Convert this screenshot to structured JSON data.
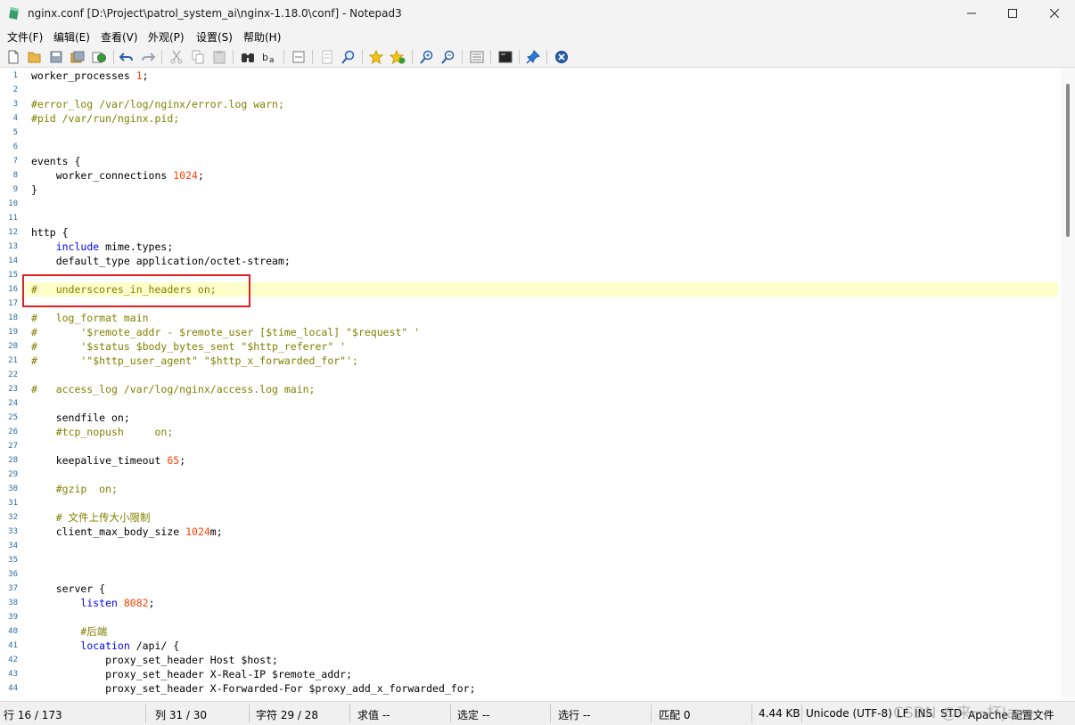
{
  "window": {
    "title": "nginx.conf [D:\\Project\\patrol_system_ai\\nginx-1.18.0\\conf] - Notepad3"
  },
  "menu": [
    "文件(F)",
    "编辑(E)",
    "查看(V)",
    "外观(P)",
    "设置(S)",
    "帮助(H)"
  ],
  "toolbar_icons": [
    "new-file-icon",
    "open-folder-icon",
    "save-icon",
    "save-all-icon",
    "browse-icon",
    "undo-icon",
    "redo-icon",
    "cut-icon",
    "copy-icon",
    "paste-icon",
    "find-icon",
    "replace-icon",
    "word-wrap-icon",
    "line-numbers-icon",
    "zoom-find-icon",
    "favorite-star-icon",
    "add-favorite-icon",
    "zoom-in-icon",
    "zoom-out-icon",
    "settings-list-icon",
    "run-icon",
    "pin-icon",
    "exit-icon"
  ],
  "editor": {
    "current_line": 16,
    "lines": [
      [
        {
          "t": "worker_processes "
        },
        {
          "t": "1",
          "c": "num"
        },
        {
          "t": ";"
        }
      ],
      [],
      [
        {
          "t": "#error_log /var/log/nginx/error.log warn;",
          "c": "cmt"
        }
      ],
      [
        {
          "t": "#pid /var/run/nginx.pid;",
          "c": "cmt"
        }
      ],
      [],
      [],
      [
        {
          "t": "events {"
        }
      ],
      [
        {
          "t": "    worker_connections "
        },
        {
          "t": "1024",
          "c": "num"
        },
        {
          "t": ";"
        }
      ],
      [
        {
          "t": "}"
        }
      ],
      [],
      [],
      [
        {
          "t": "http {"
        }
      ],
      [
        {
          "t": "    "
        },
        {
          "t": "include",
          "c": "kw"
        },
        {
          "t": " mime.types;"
        }
      ],
      [
        {
          "t": "    default_type application/octet-stream;"
        }
      ],
      [],
      [
        {
          "t": "#   underscores_in_headers on;",
          "c": "cmt"
        }
      ],
      [],
      [
        {
          "t": "#   log_format main",
          "c": "cmt"
        }
      ],
      [
        {
          "t": "#       '$remote_addr - $remote_user [$time_local] \"$request\" '",
          "c": "cmt"
        }
      ],
      [
        {
          "t": "#       '$status $body_bytes_sent \"$http_referer\" '",
          "c": "cmt"
        }
      ],
      [
        {
          "t": "#       '\"$http_user_agent\" \"$http_x_forwarded_for\"';",
          "c": "cmt"
        }
      ],
      [],
      [
        {
          "t": "#   access_log /var/log/nginx/access.log main;",
          "c": "cmt"
        }
      ],
      [],
      [
        {
          "t": "    sendfile on;"
        }
      ],
      [
        {
          "t": "    #tcp_nopush     on;",
          "c": "cmt"
        }
      ],
      [],
      [
        {
          "t": "    keepalive_timeout "
        },
        {
          "t": "65",
          "c": "num"
        },
        {
          "t": ";"
        }
      ],
      [],
      [
        {
          "t": "    #gzip  on;",
          "c": "cmt"
        }
      ],
      [],
      [
        {
          "t": "    # 文件上传大小限制",
          "c": "cmt"
        }
      ],
      [
        {
          "t": "    client_max_body_size "
        },
        {
          "t": "1024",
          "c": "num"
        },
        {
          "t": "m;"
        }
      ],
      [],
      [],
      [],
      [
        {
          "t": "    server {"
        }
      ],
      [
        {
          "t": "        "
        },
        {
          "t": "listen",
          "c": "kw"
        },
        {
          "t": " "
        },
        {
          "t": "8082",
          "c": "num"
        },
        {
          "t": ";"
        }
      ],
      [],
      [
        {
          "t": "        #后端",
          "c": "cmt"
        }
      ],
      [
        {
          "t": "        "
        },
        {
          "t": "location",
          "c": "kw"
        },
        {
          "t": " /api/ {"
        }
      ],
      [
        {
          "t": "            proxy_set_header Host $host;"
        }
      ],
      [
        {
          "t": "            proxy_set_header X-Real-IP $remote_addr;"
        }
      ],
      [
        {
          "t": "            proxy_set_header X-Forwarded-For $proxy_add_x_forwarded_for;"
        }
      ]
    ]
  },
  "status": {
    "line": "行 16 / 173",
    "col": "列  31 / 30",
    "char": "字符  29 / 28",
    "value": "求值  --",
    "selection": "选定  --",
    "sel_lines": "选行  --",
    "match": "匹配  0",
    "size": "4.44 KB",
    "encoding": "Unicode (UTF-8)",
    "eol": "LF",
    "ins": "INS",
    "std": "STD",
    "lexer": "Apache 配置文件"
  },
  "watermark": "CSDN @来一杯Java",
  "colors": {
    "keyword": "#0000ff",
    "number": "#ff4000",
    "comment": "#808000",
    "current_line": "#ffffcc",
    "highlight_box": "#e02020"
  }
}
